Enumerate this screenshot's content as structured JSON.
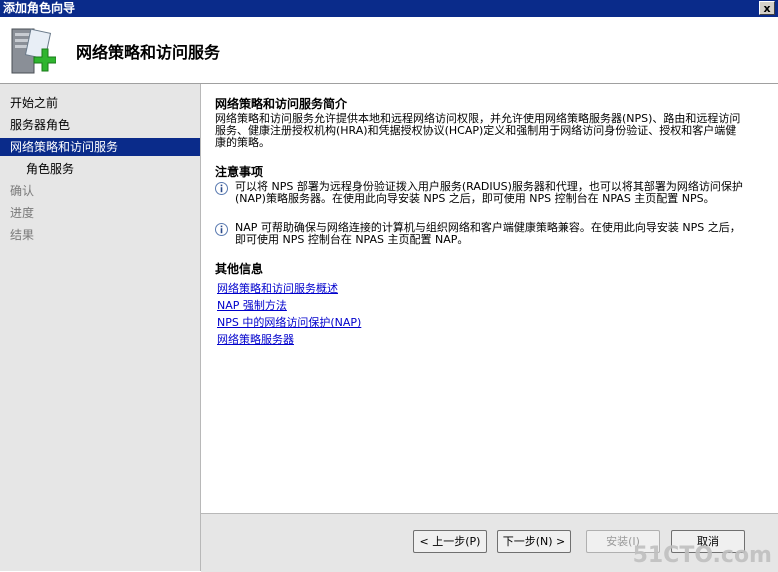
{
  "window": {
    "title": "添加角色向导",
    "close_glyph": "x"
  },
  "header": {
    "title": "网络策略和访问服务",
    "icon": "server-add-icon"
  },
  "nav": {
    "items": [
      {
        "label": "开始之前",
        "state": "normal"
      },
      {
        "label": "服务器角色",
        "state": "normal"
      },
      {
        "label": "网络策略和访问服务",
        "state": "active"
      },
      {
        "label": "角色服务",
        "state": "sub"
      },
      {
        "label": "确认",
        "state": "dim"
      },
      {
        "label": "进度",
        "state": "dim"
      },
      {
        "label": "结果",
        "state": "dim"
      }
    ]
  },
  "content": {
    "intro_title": "网络策略和访问服务简介",
    "intro_text": "网络策略和访问服务允许提供本地和远程网络访问权限，并允许使用网络策略服务器(NPS)、路由和远程访问服务、健康注册授权机构(HRA)和凭据授权协议(HCAP)定义和强制用于网络访问身份验证、授权和客户端健康的策略。",
    "notes_title": "注意事项",
    "notes": [
      "可以将 NPS 部署为远程身份验证拨入用户服务(RADIUS)服务器和代理，也可以将其部署为网络访问保护(NAP)策略服务器。在使用此向导安装 NPS 之后，即可使用 NPS 控制台在 NPAS 主页配置 NPS。",
      "NAP 可帮助确保与网络连接的计算机与组织网络和客户端健康策略兼容。在使用此向导安装 NPS 之后，即可使用 NPS 控制台在 NPAS 主页配置 NAP。"
    ],
    "more_title": "其他信息",
    "links": [
      "网络策略和访问服务概述",
      "NAP 强制方法",
      "NPS 中的网络访问保护(NAP)",
      "网络策略服务器"
    ]
  },
  "buttons": {
    "back": "< 上一步(P)",
    "next": "下一步(N) >",
    "install": "安装(I)",
    "cancel": "取消"
  },
  "watermark": "51CTO.com"
}
